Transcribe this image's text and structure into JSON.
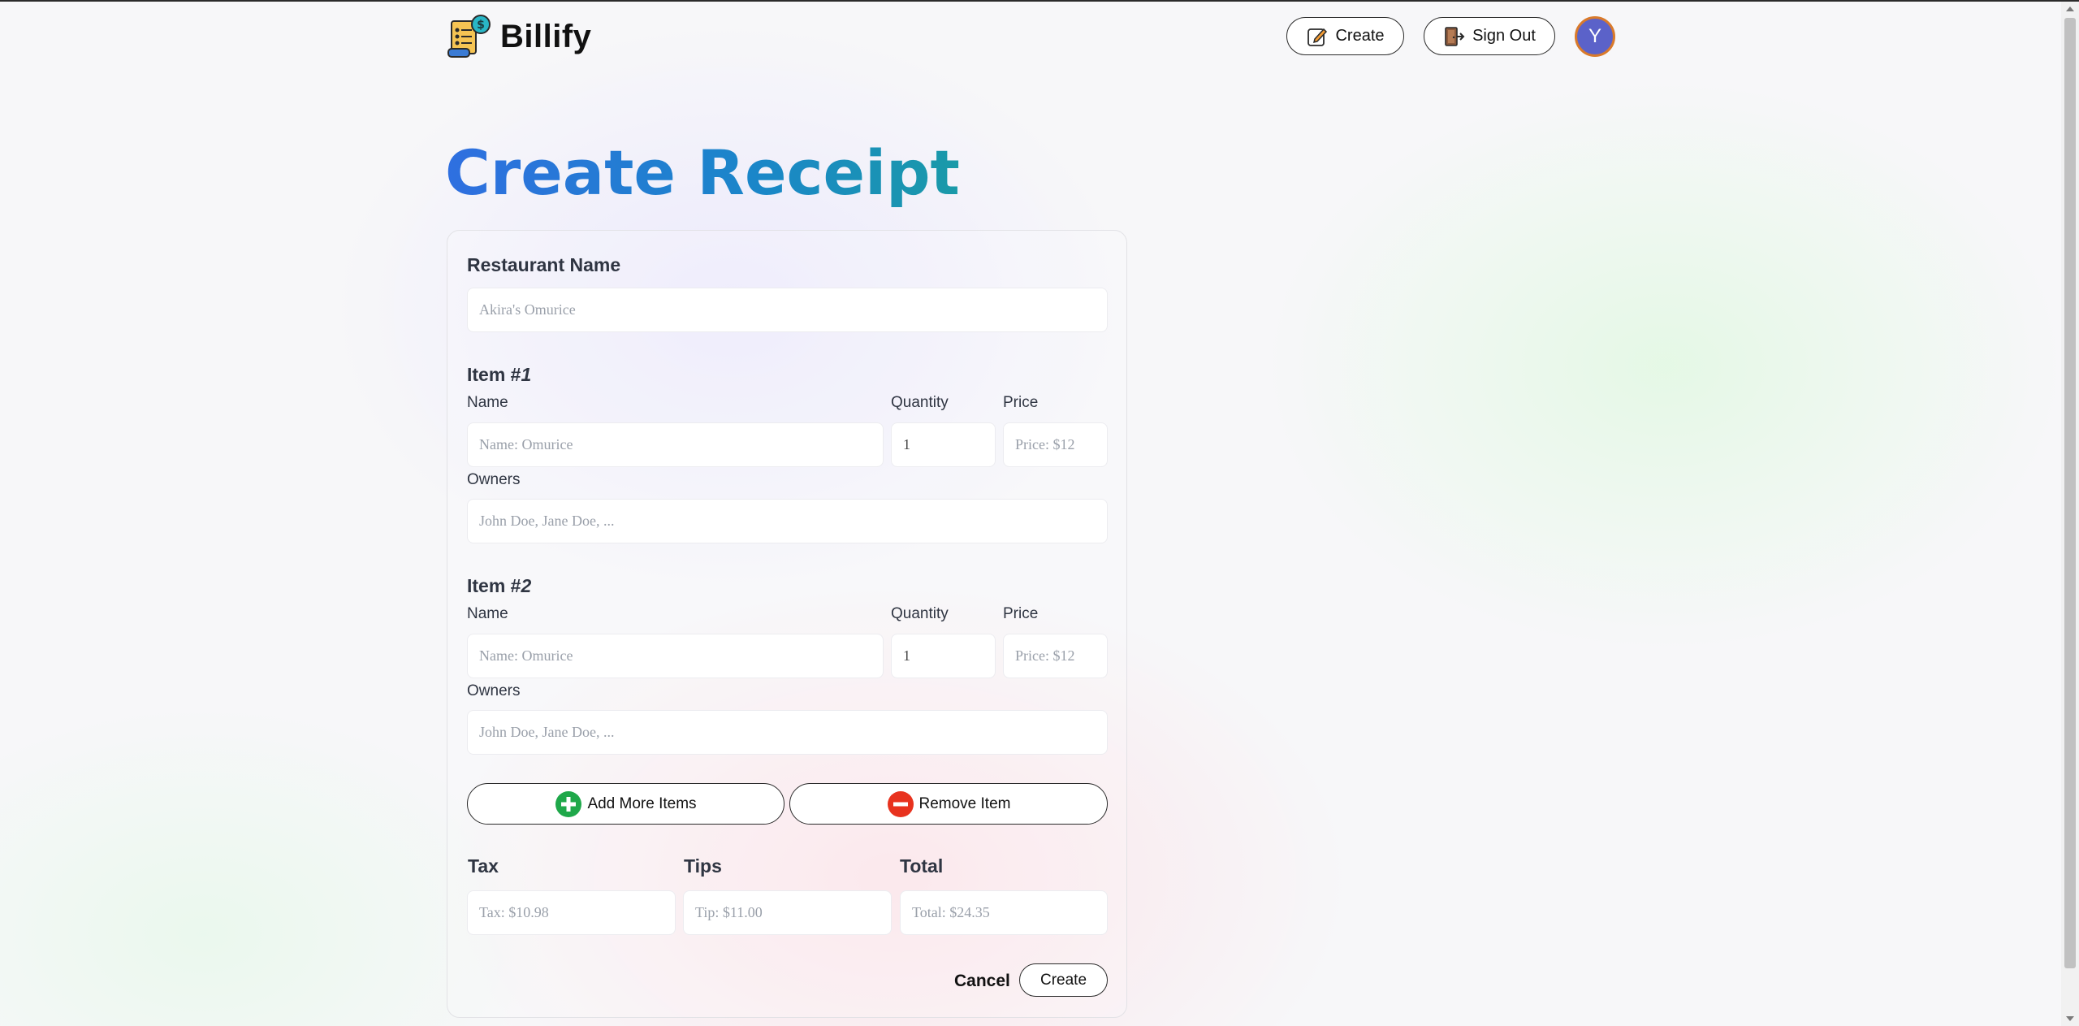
{
  "header": {
    "brand": "Billify",
    "create_label": "Create",
    "signout_label": "Sign Out",
    "avatar_initial": "Y"
  },
  "page": {
    "title": "Create Receipt"
  },
  "form": {
    "restaurant": {
      "label": "Restaurant Name",
      "placeholder": "Akira's Omurice"
    },
    "items": [
      {
        "heading": "Item #",
        "number": "1",
        "name_label": "Name",
        "name_placeholder": "Name: Omurice",
        "quantity_label": "Quantity",
        "quantity_value": "1",
        "price_label": "Price",
        "price_placeholder": "Price: $12",
        "owners_label": "Owners",
        "owners_placeholder": "John Doe, Jane Doe, ..."
      },
      {
        "heading": "Item #",
        "number": "2",
        "name_label": "Name",
        "name_placeholder": "Name: Omurice",
        "quantity_label": "Quantity",
        "quantity_value": "1",
        "price_label": "Price",
        "price_placeholder": "Price: $12",
        "owners_label": "Owners",
        "owners_placeholder": "John Doe, Jane Doe, ..."
      }
    ],
    "add_items_label": "Add More Items",
    "remove_item_label": "Remove Item",
    "tax": {
      "label": "Tax",
      "placeholder": "Tax: $10.98"
    },
    "tips": {
      "label": "Tips",
      "placeholder": "Tip: $11.00"
    },
    "total": {
      "label": "Total",
      "placeholder": "Total: $24.35"
    },
    "cancel_label": "Cancel",
    "submit_label": "Create"
  },
  "colors": {
    "title_gradient_start": "#2f6fe0",
    "title_gradient_end": "#1a9aa8",
    "add_icon": "#1fa84a",
    "remove_icon": "#e8321e",
    "avatar_bg": "#5b62c9",
    "avatar_ring": "#d97a2b"
  },
  "icons": {
    "logo": "receipt-dollar-icon",
    "create": "edit-note-icon",
    "signout": "door-exit-icon",
    "add": "plus-circle-icon",
    "remove": "minus-circle-icon"
  }
}
